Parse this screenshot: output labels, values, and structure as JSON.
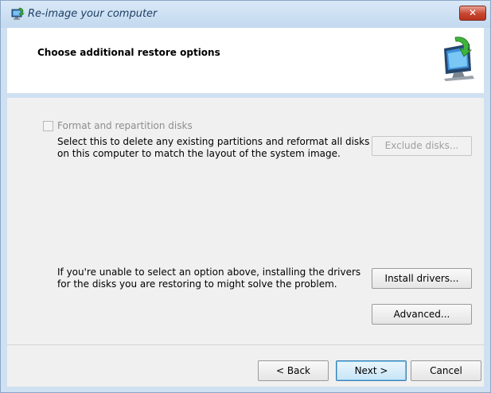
{
  "window": {
    "title": "Re-image your computer",
    "close_label": "✕"
  },
  "header": {
    "title": "Choose additional restore options"
  },
  "options": {
    "format_checkbox": {
      "label": "Format and repartition disks",
      "checked": false,
      "enabled": false
    },
    "format_description": "Select this to delete any existing partitions and reformat all disks on this computer to match the layout of the system image.",
    "exclude_button": "Exclude disks...",
    "drivers_description": "If you're unable to select an option above, installing the drivers for the disks you are restoring to might solve the problem.",
    "install_button": "Install drivers...",
    "advanced_button": "Advanced..."
  },
  "footer": {
    "back": "< Back",
    "next": "Next >",
    "cancel": "Cancel"
  },
  "icons": {
    "title": "restore-icon",
    "header": "computer-restore-icon"
  },
  "colors": {
    "frame": "#cfe0f1",
    "close": "#c7452f",
    "disabled_text": "#8d8d8d",
    "focus_border": "#3c7fb1"
  }
}
